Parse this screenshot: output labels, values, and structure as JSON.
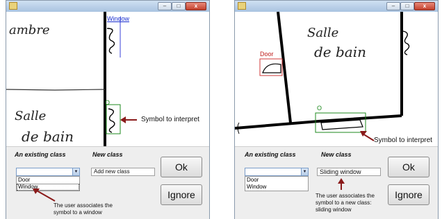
{
  "left_window": {
    "canvas": {
      "handwritten_top": "ambre",
      "handwritten_bottom_line1": "Salle",
      "handwritten_bottom_line2": "de bain",
      "detected_window_label": "Window",
      "symbol_marker": "O",
      "annotation": "Symbol to interpret"
    },
    "panel": {
      "existing_class_label": "An existing class",
      "new_class_label": "New class",
      "combo_value": "",
      "dropdown_options": [
        "Door",
        "Window"
      ],
      "dropdown_selected": "Window",
      "new_class_placeholder": "Add new class",
      "ok_label": "Ok",
      "ignore_label": "Ignore",
      "note": "The user associates the symbol to a window"
    }
  },
  "right_window": {
    "canvas": {
      "handwritten_line1": "Salle",
      "handwritten_line2": "de bain",
      "detected_door_label": "Door",
      "symbol_marker": "O",
      "annotation": "Symbol to interpret"
    },
    "panel": {
      "existing_class_label": "An existing class",
      "new_class_label": "New class",
      "combo_value": "",
      "dropdown_options": [
        "Door",
        "Window"
      ],
      "new_class_value": "Sliding window",
      "ok_label": "Ok",
      "ignore_label": "Ignore",
      "note_line1": "The user associates the",
      "note_line2": "symbol to a new class:",
      "note_line3": "sliding window"
    }
  },
  "titlebar_buttons": {
    "minimize": "–",
    "maximize": "□",
    "close": "x"
  }
}
